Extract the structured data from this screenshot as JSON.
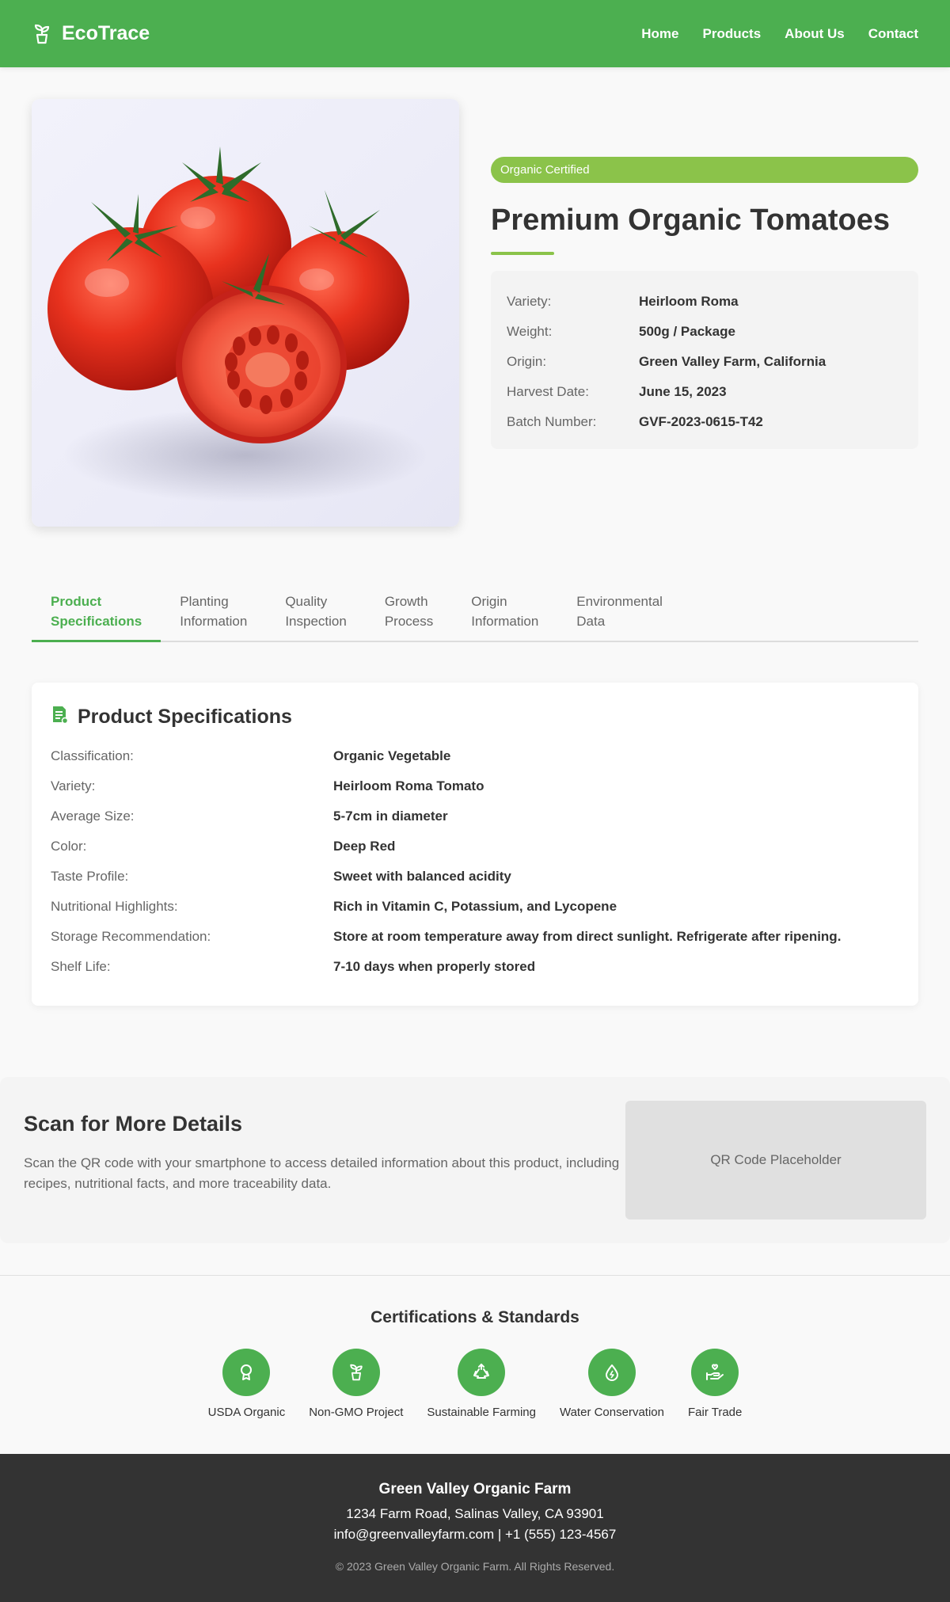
{
  "header": {
    "logo_text": "EcoTrace",
    "nav": [
      "Home",
      "Products",
      "About Us",
      "Contact"
    ]
  },
  "product": {
    "image_icon": "tomatoes-photo",
    "badge": "Organic Certified",
    "title": "Premium Organic Tomatoes",
    "info": [
      {
        "label": "Variety:",
        "value": "Heirloom Roma"
      },
      {
        "label": "Weight:",
        "value": "500g / Package"
      },
      {
        "label": "Origin:",
        "value": "Green Valley Farm, California"
      },
      {
        "label": "Harvest Date:",
        "value": "June 15, 2023"
      },
      {
        "label": "Batch Number:",
        "value": "GVF-2023-0615-T42"
      }
    ]
  },
  "tabs": [
    {
      "label": "Product\nSpecifications",
      "active": true
    },
    {
      "label": "Planting\nInformation",
      "active": false
    },
    {
      "label": "Quality\nInspection",
      "active": false
    },
    {
      "label": "Growth\nProcess",
      "active": false
    },
    {
      "label": "Origin\nInformation",
      "active": false
    },
    {
      "label": "Environmental\nData",
      "active": false
    }
  ],
  "specs": {
    "heading": "Product Specifications",
    "heading_icon": "document-icon",
    "rows": [
      {
        "label": "Classification:",
        "value": "Organic Vegetable"
      },
      {
        "label": "Variety:",
        "value": "Heirloom Roma Tomato"
      },
      {
        "label": "Average Size:",
        "value": "5-7cm in diameter"
      },
      {
        "label": "Color:",
        "value": "Deep Red"
      },
      {
        "label": "Taste Profile:",
        "value": "Sweet with balanced acidity"
      },
      {
        "label": "Nutritional Highlights:",
        "value": "Rich in Vitamin C, Potassium, and Lycopene"
      },
      {
        "label": "Storage Recommendation:",
        "value": "Store at room temperature away from direct sunlight. Refrigerate after ripening."
      },
      {
        "label": "Shelf Life:",
        "value": "7-10 days when properly stored"
      }
    ]
  },
  "qr": {
    "title": "Scan for More Details",
    "description": "Scan the QR code with your smartphone to access detailed information about this product, including recipes, nutritional facts, and more traceability data.",
    "placeholder": "QR Code Placeholder"
  },
  "certifications": {
    "title": "Certifications & Standards",
    "items": [
      {
        "label": "USDA Organic",
        "icon": "award-icon"
      },
      {
        "label": "Non-GMO Project",
        "icon": "seedling-icon"
      },
      {
        "label": "Sustainable Farming",
        "icon": "recycle-icon"
      },
      {
        "label": "Water Conservation",
        "icon": "water-drop-icon"
      },
      {
        "label": "Fair Trade",
        "icon": "hand-holding-icon"
      }
    ]
  },
  "footer": {
    "name": "Green Valley Organic Farm",
    "address": "1234 Farm Road, Salinas Valley, CA 93901",
    "contact": "info@greenvalleyfarm.com | +1 (555) 123-4567",
    "copyright": "© 2023 Green Valley Organic Farm. All Rights Reserved."
  },
  "colors": {
    "primary": "#4caf50",
    "accent": "#8bc34a",
    "footer_bg": "#333333"
  }
}
